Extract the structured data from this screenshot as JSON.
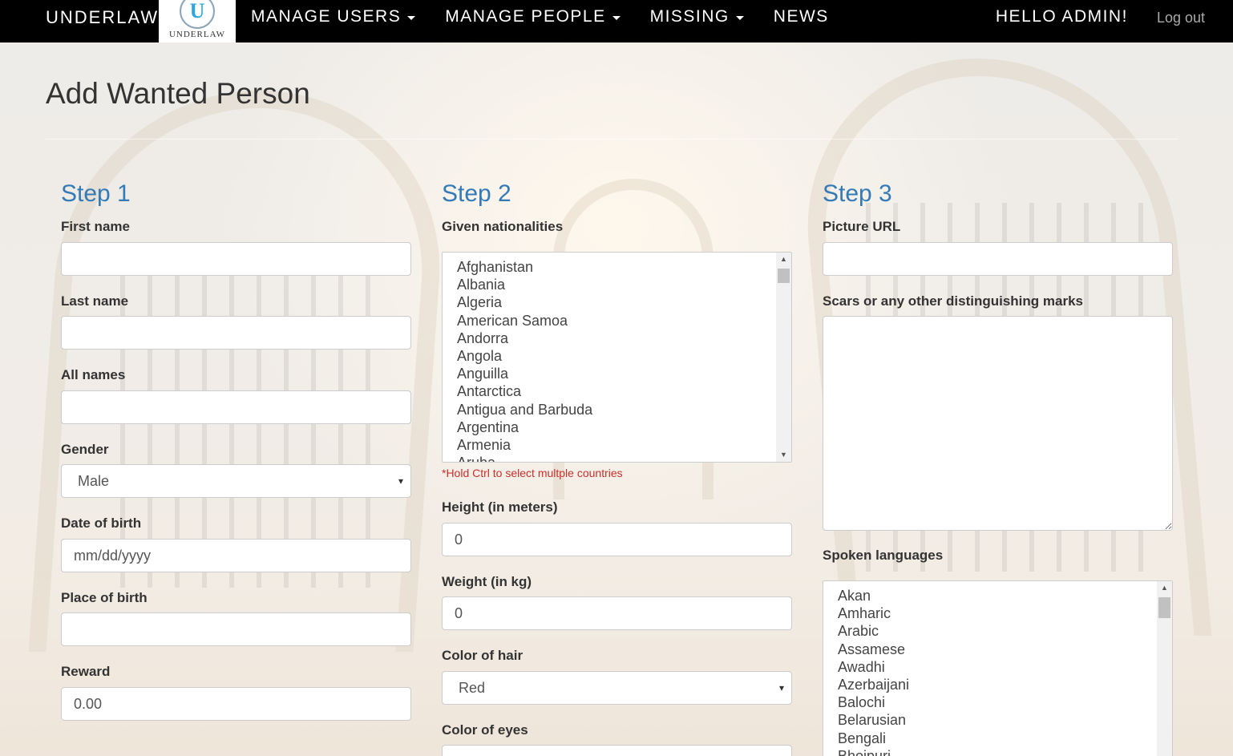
{
  "nav": {
    "brand": "UNDERLAW",
    "logo_letter": "U",
    "logo_text": "UNDERLAW",
    "items": [
      {
        "label": "MANAGE USERS"
      },
      {
        "label": "MANAGE PEOPLE"
      },
      {
        "label": "MISSING"
      },
      {
        "label": "NEWS"
      }
    ],
    "greeting": "HELLO ADMIN!",
    "logout": "Log out"
  },
  "page": {
    "title": "Add Wanted Person"
  },
  "step1": {
    "heading": "Step 1",
    "first_name_label": "First name",
    "first_name_value": "",
    "last_name_label": "Last name",
    "last_name_value": "",
    "all_names_label": "All names",
    "all_names_value": "",
    "gender_label": "Gender",
    "gender_value": "Male",
    "dob_label": "Date of birth",
    "dob_placeholder": "mm/dd/yyyy",
    "pob_label": "Place of birth",
    "pob_value": "",
    "reward_label": "Reward",
    "reward_value": "0.00"
  },
  "step2": {
    "heading": "Step 2",
    "nationalities_label": "Given nationalities",
    "nationalities": [
      "Afghanistan",
      "Albania",
      "Algeria",
      "American Samoa",
      "Andorra",
      "Angola",
      "Anguilla",
      "Antarctica",
      "Antigua and Barbuda",
      "Argentina",
      "Armenia",
      "Aruba"
    ],
    "nationalities_hint": "*Hold Ctrl to select multple countries",
    "height_label": "Height (in meters)",
    "height_value": "0",
    "weight_label": "Weight (in kg)",
    "weight_value": "0",
    "hair_label": "Color of hair",
    "hair_value": "Red",
    "eyes_label": "Color of eyes"
  },
  "step3": {
    "heading": "Step 3",
    "picture_label": "Picture URL",
    "picture_value": "",
    "scars_label": "Scars or any other distinguishing marks",
    "languages_label": "Spoken languages",
    "languages": [
      "Akan",
      "Amharic",
      "Arabic",
      "Assamese",
      "Awadhi",
      "Azerbaijani",
      "Balochi",
      "Belarusian",
      "Bengali",
      "Bhojpuri"
    ]
  },
  "colors": {
    "navbar": "#000000",
    "step_heading": "#337ab7",
    "hint": "#c9302c"
  }
}
